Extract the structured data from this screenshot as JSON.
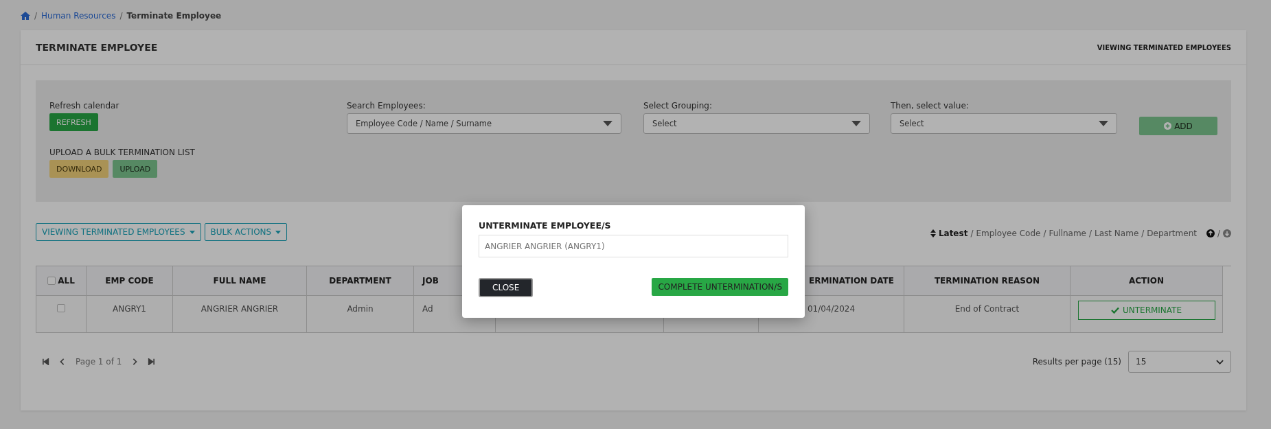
{
  "breadcrumb": {
    "separator": "/",
    "items": [
      {
        "label": "Human Resources",
        "kind": "link"
      },
      {
        "label": "Terminate Employee",
        "kind": "current"
      }
    ]
  },
  "card": {
    "title": "TERMINATE EMPLOYEE",
    "mode": "VIEWING TERMINATED EMPLOYEES"
  },
  "filters": {
    "refresh": {
      "label": "Refresh calendar",
      "button": {
        "label": "REFRESH"
      }
    },
    "bulk": {
      "label": "UPLOAD A BULK TERMINATION LIST",
      "buttons": [
        {
          "label": "DOWNLOAD",
          "kind": "warning",
          "disabled": true
        },
        {
          "label": "UPLOAD",
          "kind": "success",
          "disabled": true
        }
      ]
    },
    "selects": [
      {
        "label": "Search Employees:",
        "value": "Employee Code / Name / Surname"
      },
      {
        "label": "Select Grouping:",
        "value": "Select"
      },
      {
        "label": "Then, select value:",
        "value": "Select"
      }
    ],
    "add_button": {
      "label": "ADD",
      "disabled": true
    }
  },
  "toolbar": {
    "buttons": [
      "VIEWING TERMINATED EMPLOYEES",
      "BULK ACTIONS"
    ]
  },
  "sort": {
    "options": [
      {
        "label": "Latest",
        "selected": true
      },
      {
        "label": "Employee Code",
        "selected": false
      },
      {
        "label": "Fullname",
        "selected": false
      },
      {
        "label": "Last Name",
        "selected": false
      },
      {
        "label": "Department",
        "selected": false
      }
    ],
    "separator": "/",
    "directions": [
      {
        "kind": "up",
        "selected": true
      },
      {
        "kind": "down",
        "selected": false
      }
    ]
  },
  "table": {
    "select_all": {
      "label": "ALL",
      "checked": false
    },
    "columns": [
      "EMP CODE",
      "FULL NAME",
      "DEPARTMENT",
      "JOB",
      "",
      "",
      "ERMINATION DATE",
      "TERMINATION REASON",
      "ACTION"
    ],
    "rows": [
      {
        "checked": false,
        "cells": [
          "ANGRY1",
          "ANGRIER ANGRIER",
          "Admin",
          "Ad",
          "",
          "",
          "01/04/2024",
          "End of Contract"
        ],
        "action": "UNTERMINATE"
      }
    ]
  },
  "pagination": {
    "page": "Page 1 of 1",
    "results_label": "Results per page (15)",
    "per_page": "15"
  },
  "modal": {
    "title": "UNTERMINATE EMPLOYEE/S",
    "placeholder": "ANGRIER ANGRIER (ANGRY1)",
    "close": "CLOSE",
    "confirm": "COMPLETE UNTERMINATION/S"
  }
}
